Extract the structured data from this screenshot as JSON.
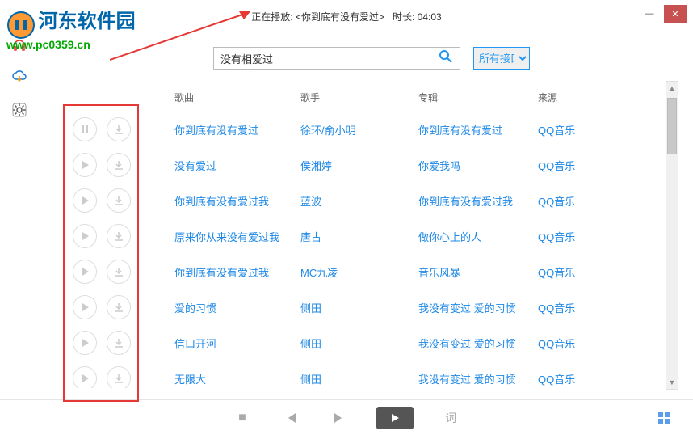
{
  "watermark": {
    "title": "河东软件园",
    "url": "www.pc0359.cn"
  },
  "header": {
    "now_playing_label": "正在播放: ",
    "track_title": "<你到底有没有爱过>",
    "duration_label": "时长: ",
    "duration": "04:03"
  },
  "search": {
    "value": "没有相爱过",
    "placeholder": "",
    "interface_value": "所有接口"
  },
  "columns": {
    "song": "歌曲",
    "artist": "歌手",
    "album": "专辑",
    "source": "来源"
  },
  "tracks": [
    {
      "playing": true,
      "song": "你到底有没有爱过",
      "artist": "徐环/俞小明",
      "album": "你到底有没有爱过",
      "source": "QQ音乐"
    },
    {
      "playing": false,
      "song": "没有爱过",
      "artist": "侯湘婷",
      "album": "你爱我吗",
      "source": "QQ音乐"
    },
    {
      "playing": false,
      "song": "你到底有没有爱过我",
      "artist": "蓝波",
      "album": "你到底有没有爱过我",
      "source": "QQ音乐"
    },
    {
      "playing": false,
      "song": "原来你从来没有爱过我",
      "artist": "唐古",
      "album": "做你心上的人",
      "source": "QQ音乐"
    },
    {
      "playing": false,
      "song": "你到底有没有爱过我",
      "artist": "MC九凌",
      "album": "音乐风暴",
      "source": "QQ音乐"
    },
    {
      "playing": false,
      "song": "爱的习惯",
      "artist": "侧田",
      "album": "我没有变过 爱的习惯",
      "source": "QQ音乐"
    },
    {
      "playing": false,
      "song": "信口开河",
      "artist": "侧田",
      "album": "我没有变过 爱的习惯",
      "source": "QQ音乐"
    },
    {
      "playing": false,
      "song": "无限大",
      "artist": "侧田",
      "album": "我没有变过 爱的习惯",
      "source": "QQ音乐"
    }
  ],
  "footer": {
    "lyric_label": "词"
  }
}
